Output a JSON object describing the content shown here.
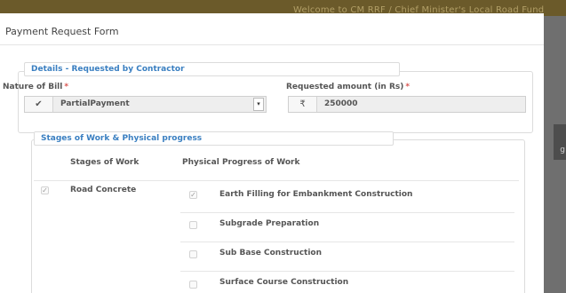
{
  "background": {
    "banner_text": "Welcome to CM RRF / Chief Minister's Local Road Fund"
  },
  "modal": {
    "title": "Payment Request Form"
  },
  "details": {
    "legend": "Details - Requested by Contractor",
    "nature_label": "Nature of Bill",
    "nature_required": "*",
    "nature_value": "PartialPayment",
    "amount_label": "Requested amount (in Rs)",
    "amount_required": "*",
    "currency_symbol": "₹",
    "amount_value": "250000"
  },
  "stages": {
    "legend": "Stages of Work & Physical progress",
    "col_stages": "Stages of Work",
    "col_progress": "Physical Progress of Work",
    "items": [
      {
        "label": "Road Concrete",
        "checked": true,
        "progress": [
          {
            "label": "Earth Filling for Embankment Construction",
            "checked": true
          },
          {
            "label": "Subgrade Preparation",
            "checked": false
          },
          {
            "label": "Sub Base Construction",
            "checked": false
          },
          {
            "label": "Surface Course Construction",
            "checked": false
          }
        ]
      }
    ]
  },
  "colors": {
    "legend_text": "#3a7fc1",
    "required": "#d9534f",
    "backdrop": "#6f6f6f"
  },
  "icons": {
    "nature_addon": "checkmark-icon",
    "amount_addon": "rupee-icon",
    "dropdown": "dropdown-arrow-icon"
  }
}
